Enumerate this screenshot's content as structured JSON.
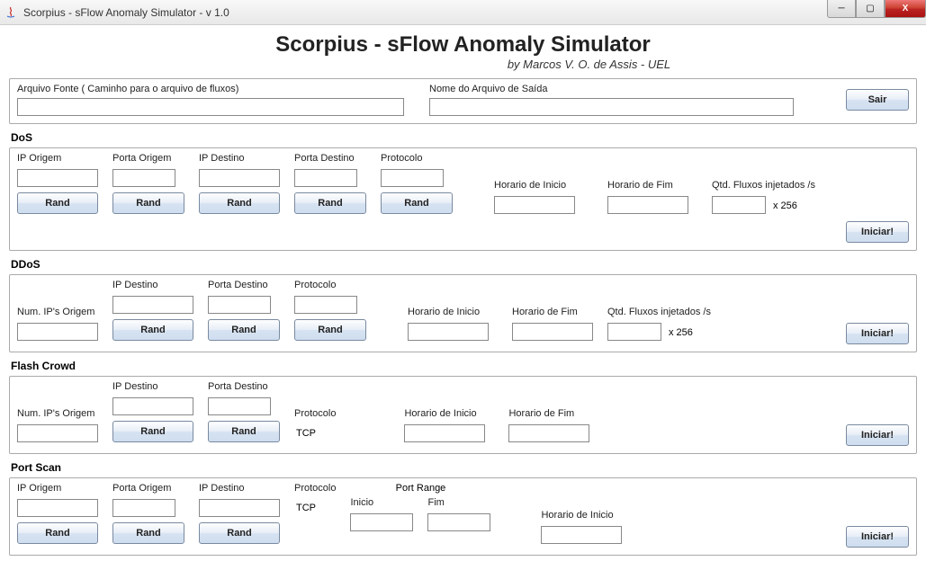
{
  "window": {
    "title": "Scorpius - sFlow Anomaly Simulator - v 1.0"
  },
  "header": {
    "title": "Scorpius - sFlow Anomaly Simulator",
    "subtitle": "by Marcos V. O. de Assis - UEL"
  },
  "file": {
    "source_label": "Arquivo Fonte ( Caminho para o arquivo de fluxos)",
    "source_value": "",
    "output_label": "Nome do Arquivo de Saída",
    "output_value": "",
    "exit_label": "Sair"
  },
  "common": {
    "rand_label": "Rand",
    "start_label": "Iniciar!",
    "ip_origem": "IP Origem",
    "porta_origem": "Porta Origem",
    "ip_destino": "IP Destino",
    "porta_destino": "Porta Destino",
    "protocolo": "Protocolo",
    "horario_inicio": "Horario de Inicio",
    "horario_fim": "Horario de Fim",
    "qtd_fluxos": "Qtd. Fluxos injetados /s",
    "x256": "x 256",
    "num_ips_origem": "Num. IP's Origem",
    "port_range": "Port Range",
    "inicio": "Inicio",
    "fim": "Fim"
  },
  "dos": {
    "title": "DoS",
    "ip_origem": "",
    "porta_origem": "",
    "ip_destino": "",
    "porta_destino": "",
    "protocolo": "",
    "h_inicio": "",
    "h_fim": "",
    "qtd": ""
  },
  "ddos": {
    "title": "DDoS",
    "num_ips": "",
    "ip_destino": "",
    "porta_destino": "",
    "protocolo": "",
    "h_inicio": "",
    "h_fim": "",
    "qtd": ""
  },
  "flash": {
    "title": "Flash Crowd",
    "num_ips": "",
    "ip_destino": "",
    "porta_destino": "",
    "protocolo": "TCP",
    "h_inicio": "",
    "h_fim": ""
  },
  "portscan": {
    "title": "Port Scan",
    "ip_origem": "",
    "porta_origem": "",
    "ip_destino": "",
    "protocolo": "TCP",
    "inicio": "",
    "fim": "",
    "h_inicio": ""
  }
}
